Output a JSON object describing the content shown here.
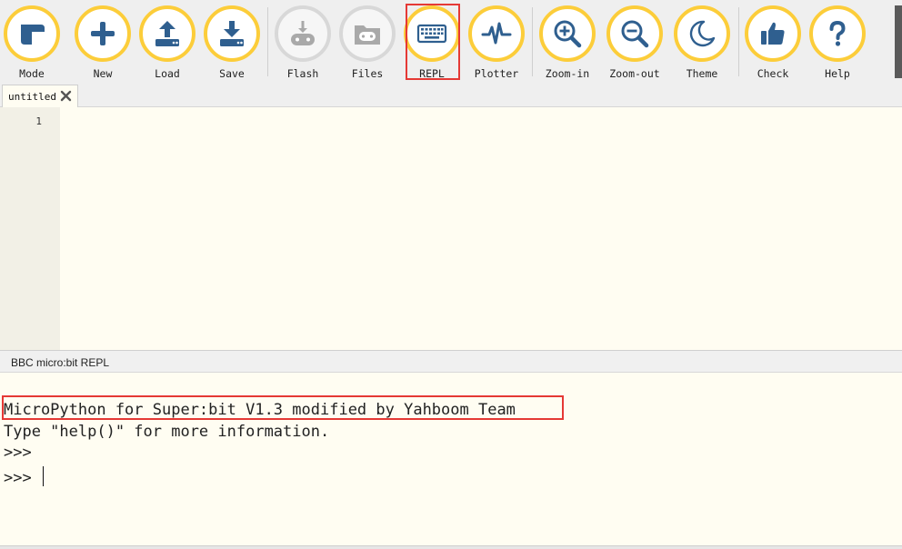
{
  "toolbar": {
    "buttons": [
      {
        "id": "mode",
        "label": "Mode",
        "icon": "mode-icon"
      },
      {
        "id": "new",
        "label": "New",
        "icon": "plus-icon"
      },
      {
        "id": "load",
        "label": "Load",
        "icon": "upload-icon"
      },
      {
        "id": "save",
        "label": "Save",
        "icon": "download-icon"
      },
      {
        "id": "flash",
        "label": "Flash",
        "icon": "flash-icon",
        "disabled": true
      },
      {
        "id": "files",
        "label": "Files",
        "icon": "microbit-icon",
        "disabled": true
      },
      {
        "id": "repl",
        "label": "REPL",
        "icon": "keyboard-icon"
      },
      {
        "id": "plotter",
        "label": "Plotter",
        "icon": "pulse-icon"
      },
      {
        "id": "zoom-in",
        "label": "Zoom-in",
        "icon": "zoom-in-icon"
      },
      {
        "id": "zoom-out",
        "label": "Zoom-out",
        "icon": "zoom-out-icon"
      },
      {
        "id": "theme",
        "label": "Theme",
        "icon": "moon-icon"
      },
      {
        "id": "check",
        "label": "Check",
        "icon": "thumbs-up-icon"
      },
      {
        "id": "help",
        "label": "Help",
        "icon": "question-icon"
      }
    ]
  },
  "tabs": [
    {
      "label": "untitled",
      "close_icon": "close-icon"
    }
  ],
  "editor": {
    "line_numbers": [
      "1"
    ],
    "content": ""
  },
  "repl": {
    "title": "BBC micro:bit REPL",
    "lines": [
      "MicroPython for Super:bit V1.3 modified by Yahboom Team",
      "Type \"help()\" for more information.",
      ">>>",
      ">>> "
    ]
  },
  "colors": {
    "accent_ring": "#fccd3a",
    "icon_blue": "#2f5f8f",
    "disabled_ring": "#d8d8d8",
    "editor_bg": "#fffdf2",
    "highlight_red": "#e53935"
  }
}
